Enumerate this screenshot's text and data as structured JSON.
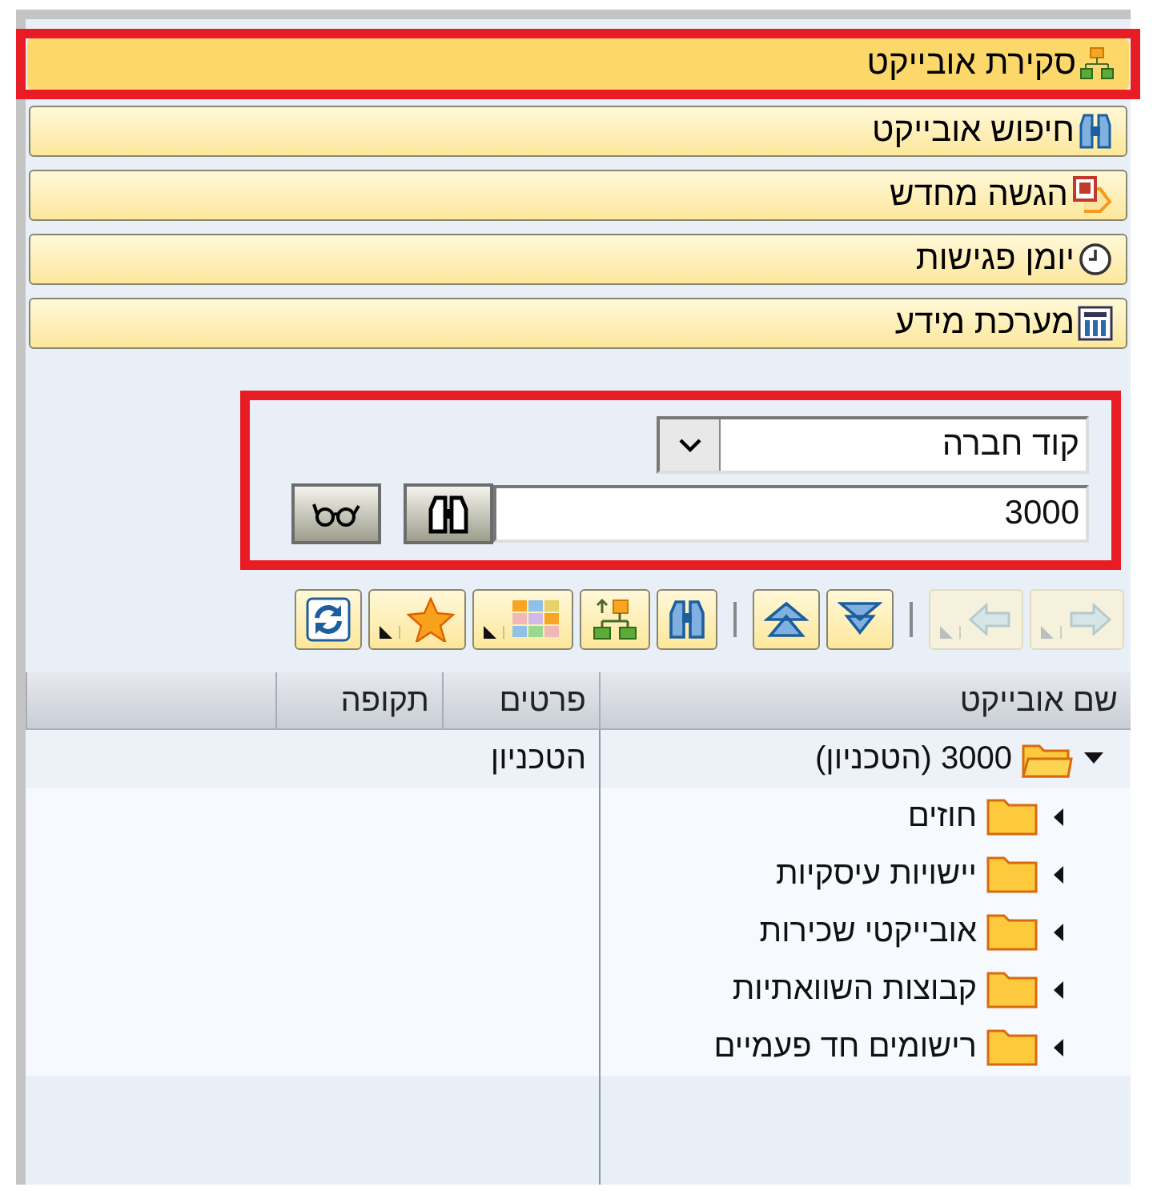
{
  "nav_buttons": [
    {
      "label": "סקירת אובייקט",
      "selected": true,
      "highlighted": true
    },
    {
      "label": "חיפוש אובייקט",
      "selected": false,
      "highlighted": false
    },
    {
      "label": "הגשה מחדש",
      "selected": false,
      "highlighted": false
    },
    {
      "label": "יומן פגישות",
      "selected": false,
      "highlighted": false
    },
    {
      "label": "מערכת מידע",
      "selected": false,
      "highlighted": false
    }
  ],
  "search": {
    "highlighted": true,
    "field": "קוד חברה",
    "value": "3000"
  },
  "toolbar": [
    {
      "kind": "next",
      "disabled": true
    },
    {
      "kind": "back",
      "disabled": true
    },
    {
      "kind": "collapse",
      "disabled": false
    },
    {
      "kind": "expand",
      "disabled": false
    },
    {
      "kind": "find",
      "disabled": false
    },
    {
      "kind": "hierarchy",
      "disabled": false
    },
    {
      "kind": "layout",
      "disabled": false
    },
    {
      "kind": "favorites",
      "disabled": false
    },
    {
      "kind": "refresh",
      "disabled": false
    }
  ],
  "tree": {
    "columns": [
      "שם אובייקט",
      "פרטים",
      "תקופה"
    ],
    "rows": [
      {
        "name": "3000 (הטכניון)",
        "details": "הטכניון",
        "expanded": true,
        "children": [
          {
            "name": "חוזים",
            "expanded": false
          },
          {
            "name": "יישויות עיסקיות",
            "expanded": false
          },
          {
            "name": "אובייקטי שכירות",
            "expanded": false
          },
          {
            "name": "קבוצות השוואתיות",
            "expanded": false
          },
          {
            "name": "רישומים חד פעמיים",
            "expanded": false
          }
        ]
      }
    ]
  }
}
